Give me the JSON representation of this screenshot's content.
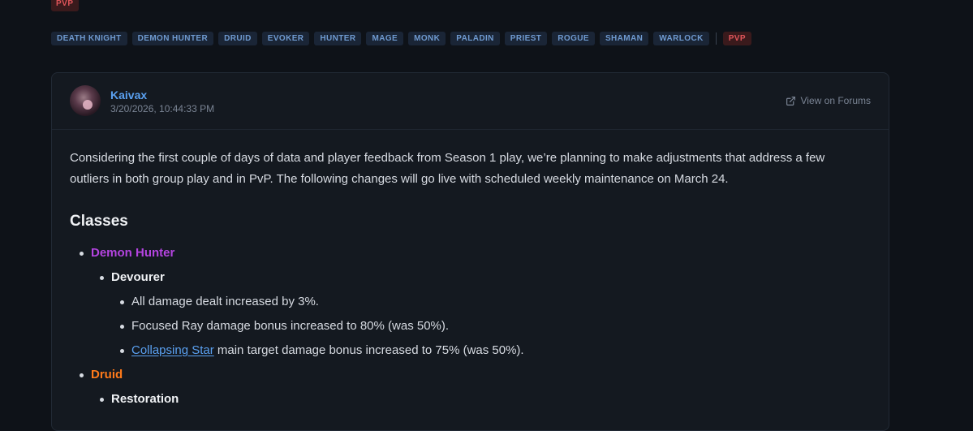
{
  "top_tag": "PVP",
  "tags": [
    "DEATH KNIGHT",
    "DEMON HUNTER",
    "DRUID",
    "EVOKER",
    "HUNTER",
    "MAGE",
    "MONK",
    "PALADIN",
    "PRIEST",
    "ROGUE",
    "SHAMAN",
    "WARLOCK"
  ],
  "pvp_tag": "PVP",
  "post": {
    "author": "Kaivax",
    "timestamp": "3/20/2026, 10:44:33 PM",
    "view_forums": "View on Forums",
    "intro_line1": "Considering the first couple of days of data and player feedback from Season 1 play, we’re planning to make adjustments that address a few",
    "intro_line2": "outliers in both group play and in PvP. The following changes will go live with scheduled weekly maintenance on March 24.",
    "section_title": "Classes",
    "class1": "Demon Hunter",
    "spec1": "Devourer",
    "change1": "All damage dealt increased by 3%.",
    "change2": "Focused Ray damage bonus increased to 80% (was 50%).",
    "change3_link": "Collapsing Star",
    "change3_rest": " main target damage bonus increased to 75% (was 50%).",
    "class2": "Druid",
    "spec2": "Restoration"
  },
  "colors": {
    "demon_hunter": "#b444e0",
    "druid": "#ff7a1a",
    "link": "#5aa0f0",
    "pvp": "#e0555a"
  },
  "icons": {
    "external_link": "external-link-icon"
  }
}
